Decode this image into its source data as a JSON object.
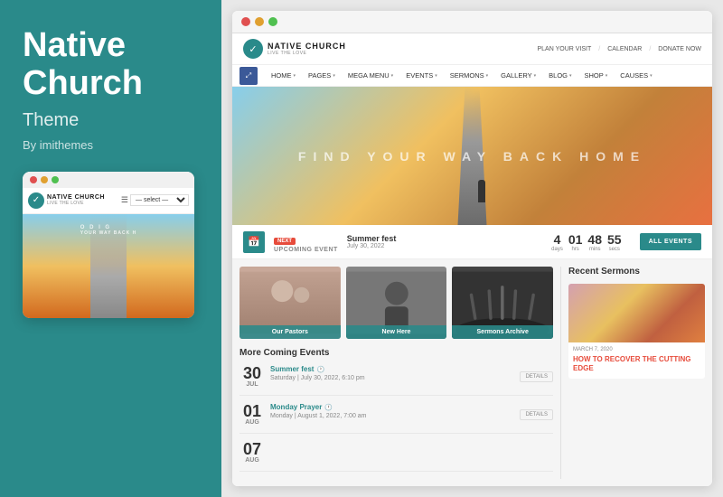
{
  "theme": {
    "title": "Native\nChurch",
    "subtitle": "Theme",
    "author": "By imithemes",
    "title_line1": "Native",
    "title_line2": "Church"
  },
  "colors": {
    "teal": "#2a8a8a",
    "red": "#e74c3c",
    "dot1": "#e05050",
    "dot2": "#e0a030",
    "dot3": "#50c050"
  },
  "site": {
    "logo_name": "NATIVE CHURCH",
    "logo_tagline": "LIVE THE LOVE",
    "header_links": [
      "PLAN YOUR VISIT",
      "CALENDAR",
      "DONATE NOW"
    ],
    "nav_items": [
      "HOME",
      "PAGES",
      "MEGA MENU",
      "EVENTS",
      "SERMONS",
      "GALLERY",
      "BLOG",
      "SHOP",
      "CAUSES"
    ],
    "hero_text": "FIND YOUR WAY BACK HOME",
    "event_badge": "NEXT",
    "event_label": "UPCOMING EVENT",
    "event_name": "Summer fest",
    "event_date": "July 30, 2022",
    "countdown": {
      "days": "4",
      "hrs": "01",
      "mins": "48",
      "secs": "55",
      "labels": [
        "days",
        "hrs",
        "mins",
        "secs"
      ]
    },
    "all_events_btn": "ALL EVENTS",
    "image_cards": [
      {
        "label": "Our Pastors"
      },
      {
        "label": "New Here"
      },
      {
        "label": "Sermons Archive"
      }
    ],
    "coming_events_title": "More Coming Events",
    "events": [
      {
        "day": "30",
        "month": "JUL",
        "title": "Summer fest",
        "has_clock": true,
        "when": "Saturday | July 30, 2022, 6:10 pm",
        "details": "DETAILS"
      },
      {
        "day": "01",
        "month": "AUG",
        "title": "Monday Prayer",
        "has_clock": true,
        "when": "Monday | August 1, 2022, 7:00 am",
        "details": "DETAILS"
      },
      {
        "day": "07",
        "month": "AUG",
        "title": "",
        "has_clock": false,
        "when": "",
        "details": ""
      }
    ],
    "recent_sermons_title": "Recent Sermons",
    "sermon": {
      "meta": "MARCH 7, 2020",
      "title": "HOW TO RECOVER THE CUTTING EDGE"
    }
  },
  "mobile_preview": {
    "logo": "NATIVE CHURCH",
    "hero_text": "O D I G\nYOUR WAY BACK H"
  }
}
